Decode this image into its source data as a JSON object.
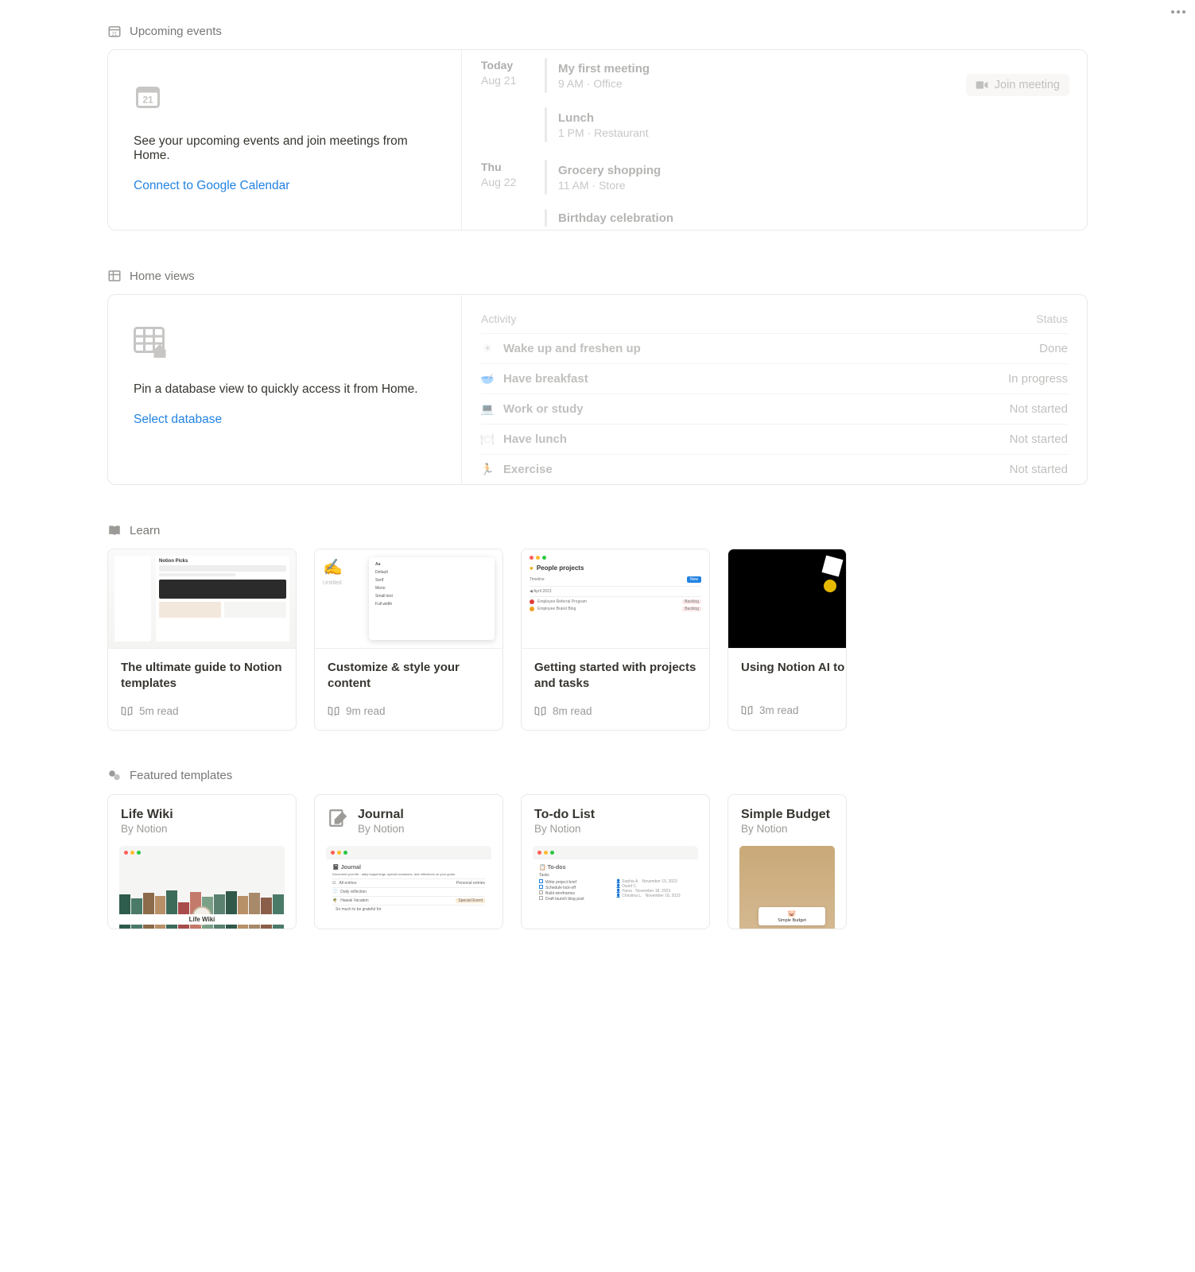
{
  "menu_dots": "page-options",
  "upcoming": {
    "header": "Upcoming events",
    "help": "See your upcoming events and join meetings from Home.",
    "link": "Connect to Google Calendar",
    "join_label": "Join meeting",
    "days": [
      {
        "label": "Today",
        "sub": "Aug 21"
      },
      {
        "label": "Thu",
        "sub": "Aug 22"
      }
    ],
    "events_day1": [
      {
        "title": "My first meeting",
        "meta": "9 AM · Office"
      },
      {
        "title": "Lunch",
        "meta": "1 PM · Restaurant"
      }
    ],
    "events_day2": [
      {
        "title": "Grocery shopping",
        "meta": "11 AM · Store"
      },
      {
        "title": "Birthday celebration",
        "meta": ""
      }
    ]
  },
  "homeviews": {
    "header": "Home views",
    "help": "Pin a database view to quickly access it from Home.",
    "link": "Select database",
    "col_activity": "Activity",
    "col_status": "Status",
    "rows": [
      {
        "icon": "☀",
        "title": "Wake up and freshen up",
        "status": "Done"
      },
      {
        "icon": "🥣",
        "title": "Have breakfast",
        "status": "In progress"
      },
      {
        "icon": "💻",
        "title": "Work or study",
        "status": "Not started"
      },
      {
        "icon": "🍽",
        "title": "Have lunch",
        "status": "Not started"
      },
      {
        "icon": "🏃",
        "title": "Exercise",
        "status": "Not started"
      }
    ]
  },
  "learn": {
    "header": "Learn",
    "cards": [
      {
        "title": "The ultimate guide to Notion templates",
        "meta": "5m read"
      },
      {
        "title": "Customize & style your content",
        "meta": "9m read"
      },
      {
        "title": "Getting started with projects and tasks",
        "meta": "8m read"
      },
      {
        "title": "Using Notion AI to maximize your impact",
        "meta": "3m read"
      }
    ],
    "thumb1_head": "Notion Picks",
    "thumb3_head": "People projects"
  },
  "templates": {
    "header": "Featured templates",
    "cards": [
      {
        "title": "Life Wiki",
        "by": "By Notion",
        "preview_label": "Life Wiki"
      },
      {
        "title": "Journal",
        "by": "By Notion",
        "preview_title": "📓 Journal"
      },
      {
        "title": "To-do List",
        "by": "By Notion",
        "preview_title": "📋 To-dos"
      },
      {
        "title": "Simple Budget",
        "by": "By Notion",
        "preview_title": "Simple Budget"
      }
    ]
  }
}
